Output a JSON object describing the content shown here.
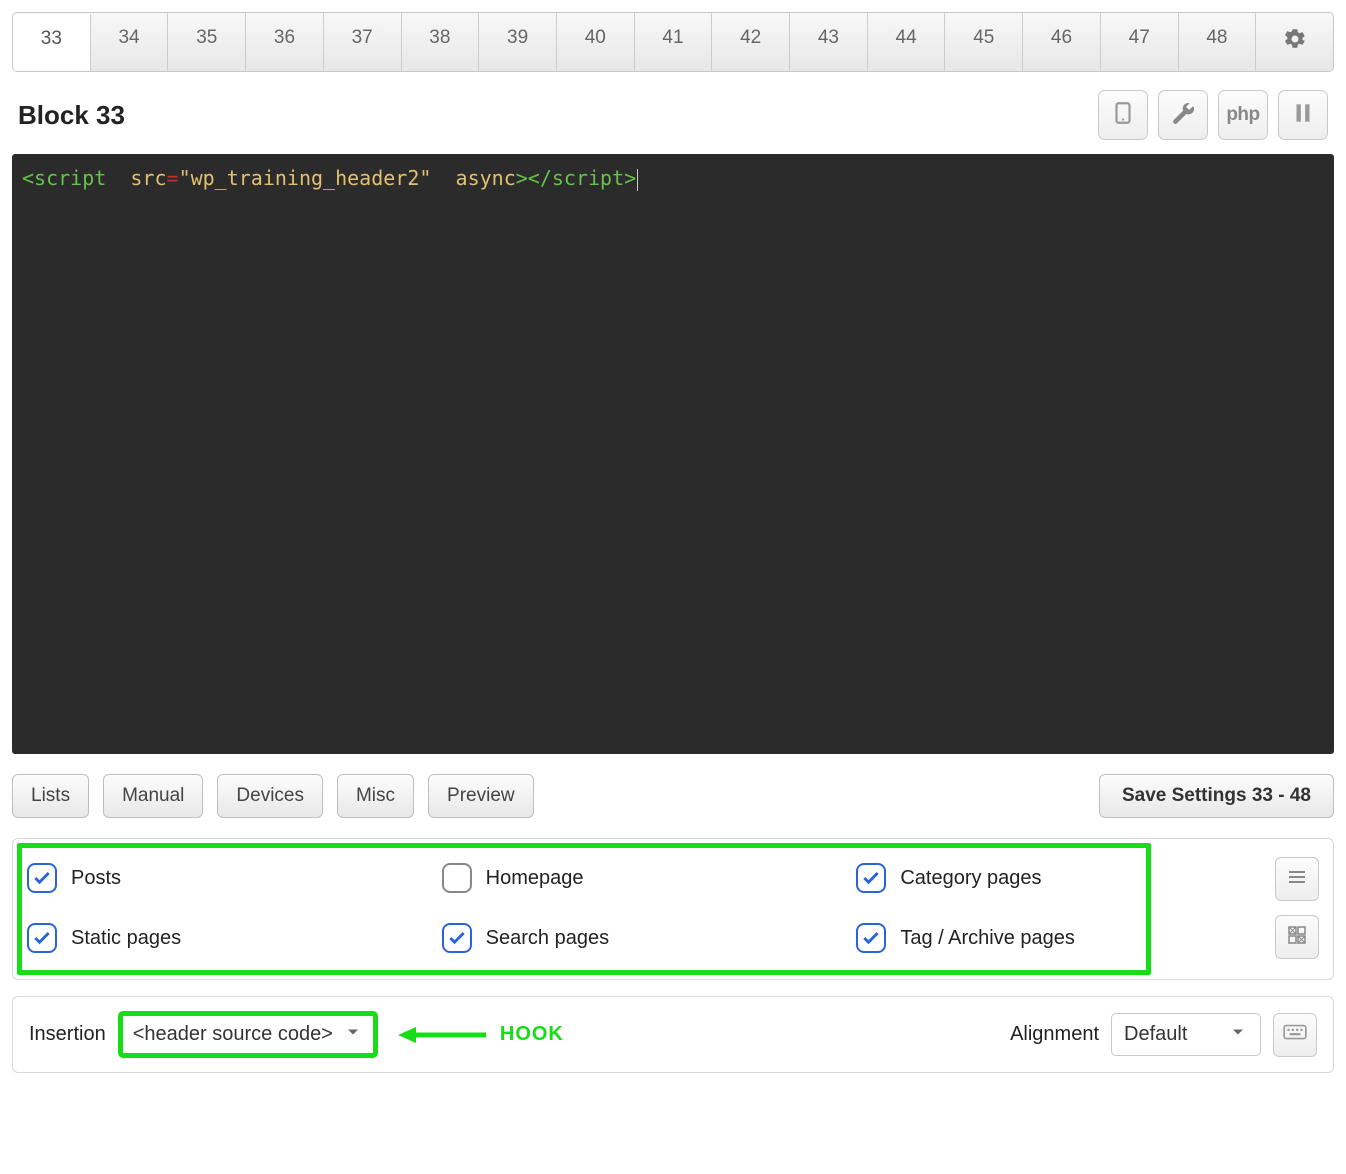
{
  "tabs": {
    "items": [
      "33",
      "34",
      "35",
      "36",
      "37",
      "38",
      "39",
      "40",
      "41",
      "42",
      "43",
      "44",
      "45",
      "46",
      "47",
      "48"
    ],
    "active": "33",
    "settings_icon": "gear"
  },
  "block": {
    "title": "Block 33"
  },
  "tools": {
    "device_icon": "device",
    "wrench_icon": "wrench",
    "php_label": "php",
    "pause_icon": "pause"
  },
  "code": {
    "open_tag": "<script",
    "attr_src_name": "src",
    "eq": "=",
    "attr_src_value": "\"wp_training_header2\"",
    "attr_async": "async",
    "close_open": ">",
    "close_tag": "</script>"
  },
  "buttons": {
    "lists": "Lists",
    "manual": "Manual",
    "devices": "Devices",
    "misc": "Misc",
    "preview": "Preview",
    "save": "Save Settings 33 - 48"
  },
  "pages": {
    "posts": {
      "label": "Posts",
      "checked": true
    },
    "homepage": {
      "label": "Homepage",
      "checked": false
    },
    "category": {
      "label": "Category pages",
      "checked": true
    },
    "static": {
      "label": "Static pages",
      "checked": true
    },
    "search": {
      "label": "Search pages",
      "checked": true
    },
    "tag": {
      "label": "Tag / Archive pages",
      "checked": true
    }
  },
  "side_icons": {
    "list": "list-lines",
    "grid": "grid-squares"
  },
  "insertion": {
    "label": "Insertion",
    "value": "<header source code>",
    "annotation": "HOOK"
  },
  "alignment": {
    "label": "Alignment",
    "value": "Default",
    "kbd_icon": "keyboard"
  }
}
